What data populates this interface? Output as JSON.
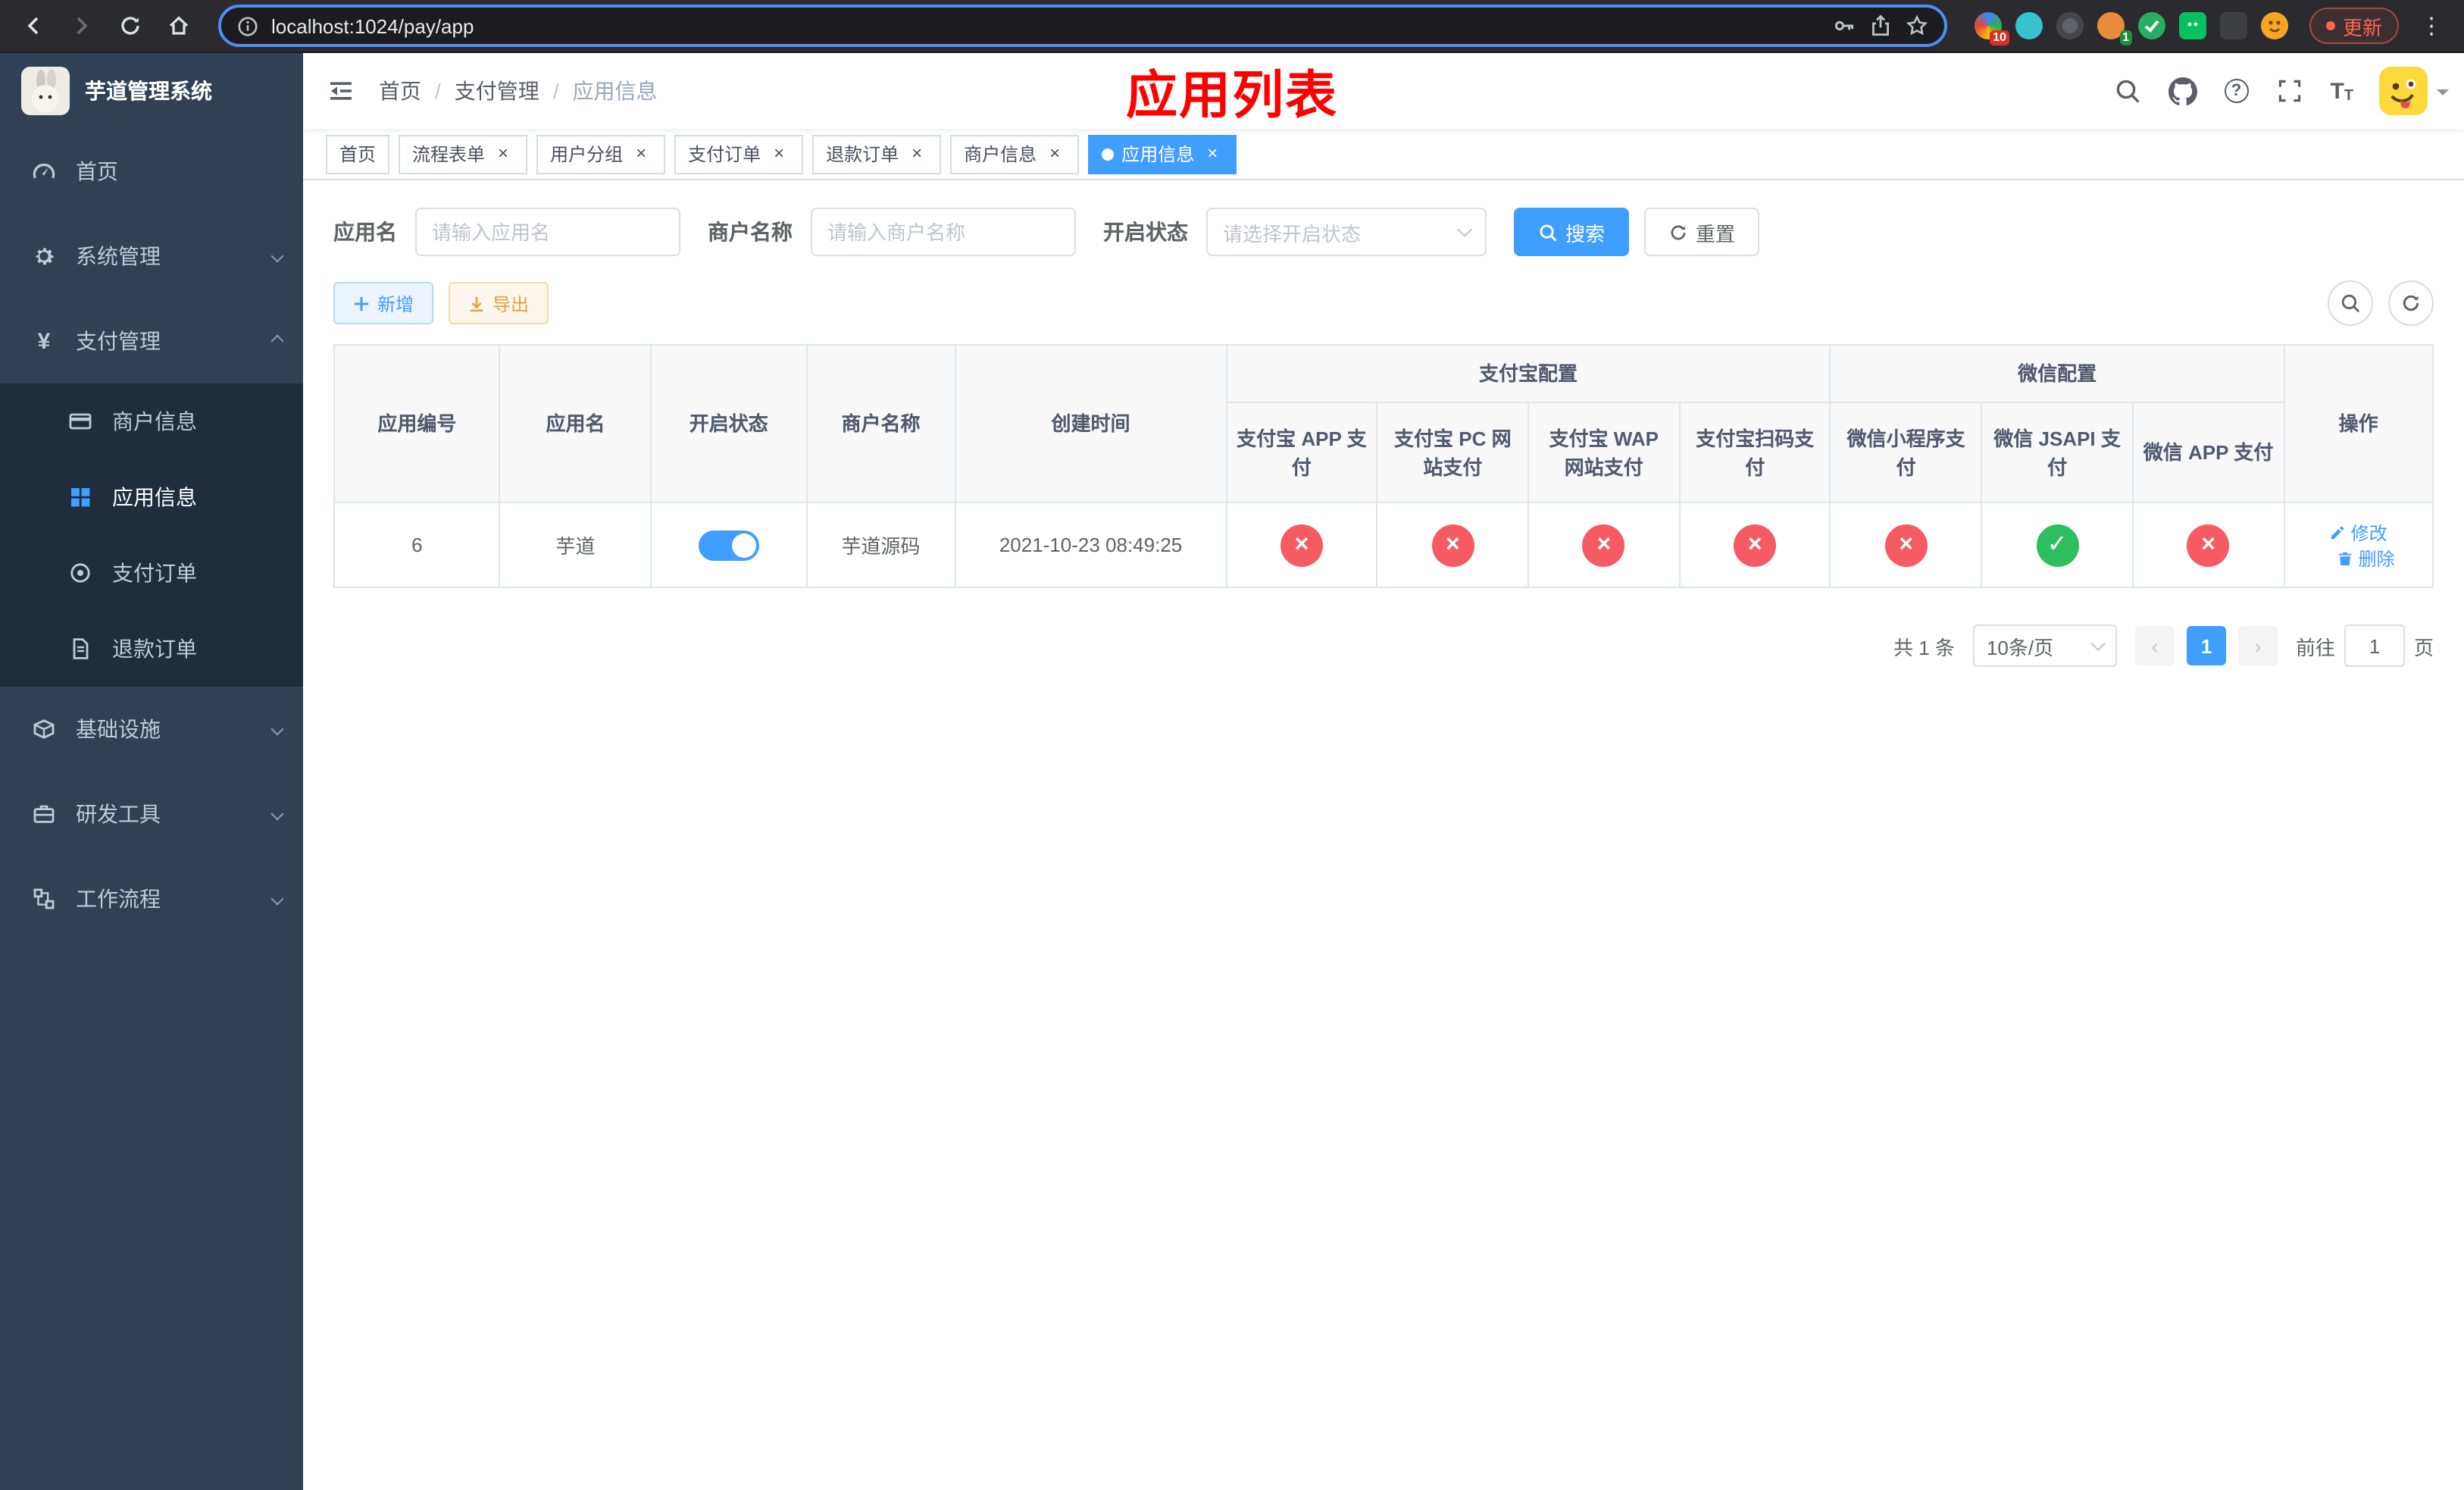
{
  "colors": {
    "primary": "#409eff",
    "success": "#2dbe60",
    "danger": "#f65b63",
    "warning": "#e6a23c",
    "annotation": "#ff0000",
    "sidebar-bg": "#304156",
    "submenu-bg": "#1f2d3d",
    "sidebar-text": "#bfcbd9",
    "tag-active": "#409eff",
    "chrome-bg": "#2b2b2f",
    "omnibox-bg": "#1c1c20",
    "omnibox-ring": "#4d8ef7",
    "update": "#ff6352"
  },
  "browser": {
    "url": "localhost:1024/pay/app",
    "update_label": "更新",
    "extension_badge_1": "10",
    "extension_badge_2": "1"
  },
  "sidebar": {
    "title": "芋道管理系统",
    "menu": [
      {
        "label": "首页"
      },
      {
        "label": "系统管理"
      },
      {
        "label": "支付管理"
      },
      {
        "label": "商户信息"
      },
      {
        "label": "应用信息"
      },
      {
        "label": "支付订单"
      },
      {
        "label": "退款订单"
      },
      {
        "label": "基础设施"
      },
      {
        "label": "研发工具"
      },
      {
        "label": "工作流程"
      }
    ]
  },
  "navbar": {
    "breadcrumb": [
      "首页",
      "支付管理",
      "应用信息"
    ],
    "annotation": "应用列表"
  },
  "tabs": [
    {
      "label": "首页"
    },
    {
      "label": "流程表单"
    },
    {
      "label": "用户分组"
    },
    {
      "label": "支付订单"
    },
    {
      "label": "退款订单"
    },
    {
      "label": "商户信息"
    },
    {
      "label": "应用信息"
    }
  ],
  "filters": {
    "app_name_label": "应用名",
    "app_name_placeholder": "请输入应用名",
    "merchant_label": "商户名称",
    "merchant_placeholder": "请输入商户名称",
    "status_label": "开启状态",
    "status_placeholder": "请选择开启状态",
    "search_label": "搜索",
    "reset_label": "重置"
  },
  "toolbar": {
    "add_label": "新增",
    "export_label": "导出"
  },
  "table": {
    "groups": {
      "alipay": "支付宝配置",
      "wechat": "微信配置"
    },
    "headers": {
      "app_id": "应用编号",
      "app_name": "应用名",
      "status": "开启状态",
      "merchant": "商户名称",
      "created": "创建时间",
      "alipay_app": "支付宝 APP 支付",
      "alipay_pc": "支付宝 PC 网站支付",
      "alipay_wap": "支付宝 WAP 网站支付",
      "alipay_qr": "支付宝扫码支付",
      "wechat_lite": "微信小程序支付",
      "wechat_jsapi": "微信 JSAPI 支付",
      "wechat_app": "微信 APP 支付",
      "actions": "操作"
    },
    "rows": [
      {
        "app_id": "6",
        "app_name": "芋道",
        "status_on": true,
        "merchant": "芋道源码",
        "created": "2021-10-23 08:49:25",
        "configs": [
          "disabled",
          "disabled",
          "disabled",
          "disabled",
          "disabled",
          "enabled",
          "disabled"
        ],
        "edit_label": "修改",
        "delete_label": "删除"
      }
    ]
  },
  "pagination": {
    "total": "共 1 条",
    "page_size": "10条/页",
    "page": "1",
    "goto_prefix": "前往",
    "goto_value": "1",
    "goto_suffix": "页"
  }
}
